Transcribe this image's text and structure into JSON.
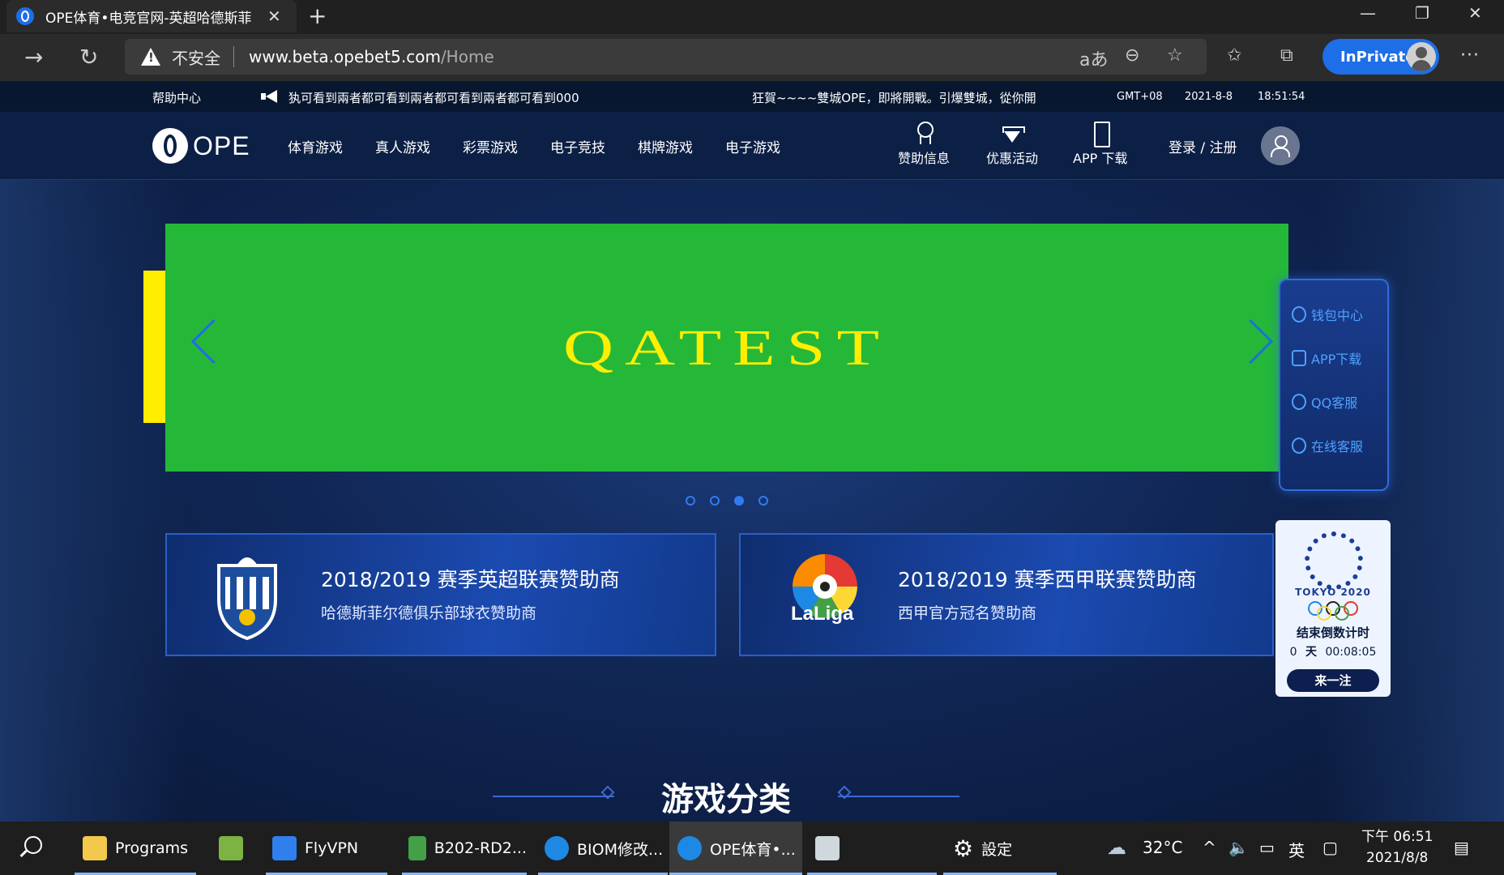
{
  "browser": {
    "tab_title": "OPE体育•电竞官网-英超哈德斯菲",
    "insecure_label": "不安全",
    "url_host": "www.beta.opebet5.com",
    "url_path": "/Home",
    "inprivate_label": "InPrivate",
    "translate_icon": "aあ"
  },
  "infobar": {
    "help": "帮助中心",
    "marquee": "犱可看到兩者都可看到兩者都可看到兩者都可看到000",
    "notice": "狂賀~~~~雙城OPE，即將開戰。引爆雙城，從你開",
    "timezone": "GMT+08",
    "date": "2021-8-8",
    "time": "18:51:54"
  },
  "sitenav": {
    "logo_text": "OPE",
    "items": [
      "体育游戏",
      "真人游戏",
      "彩票游戏",
      "电子竞技",
      "棋牌游戏",
      "电子游戏"
    ],
    "icon_items": [
      {
        "label": "赞助信息",
        "icon": "medal-icon"
      },
      {
        "label": "优惠活动",
        "icon": "diamond-icon"
      },
      {
        "label": "APP 下载",
        "icon": "phone-icon"
      }
    ],
    "login": "登录 / 注册"
  },
  "banner": {
    "text": "QATEST",
    "background": "#25b838",
    "text_color": "#ffee00",
    "slide_count": 4,
    "active_slide": 3
  },
  "sidepanel": {
    "items": [
      "钱包中心",
      "APP下载",
      "QQ客服",
      "在线客服"
    ]
  },
  "sponsors": [
    {
      "title": "2018/2019 赛季英超联赛赞助商",
      "subtitle": "哈德斯菲尔德俱乐部球衣赞助商"
    },
    {
      "title": "2018/2019 赛季西甲联赛赞助商",
      "subtitle": "西甲官方冠名赞助商",
      "logo_text": "LaLiga"
    }
  ],
  "tokyo": {
    "label": "TOKYO 2020",
    "countdown_title": "结束倒数计时",
    "days": "0",
    "days_unit": "天",
    "clock": "00:08:05",
    "button": "来一注"
  },
  "section": {
    "title": "游戏分类"
  },
  "taskbar": {
    "items": [
      "Programs",
      "FlyVPN",
      "B202-RD2...",
      "BIOM修改...",
      "OPE体育•...",
      "設定"
    ],
    "weather": "32°C",
    "ime": "英",
    "clock_time": "下午 06:51",
    "clock_date": "2021/8/8"
  }
}
